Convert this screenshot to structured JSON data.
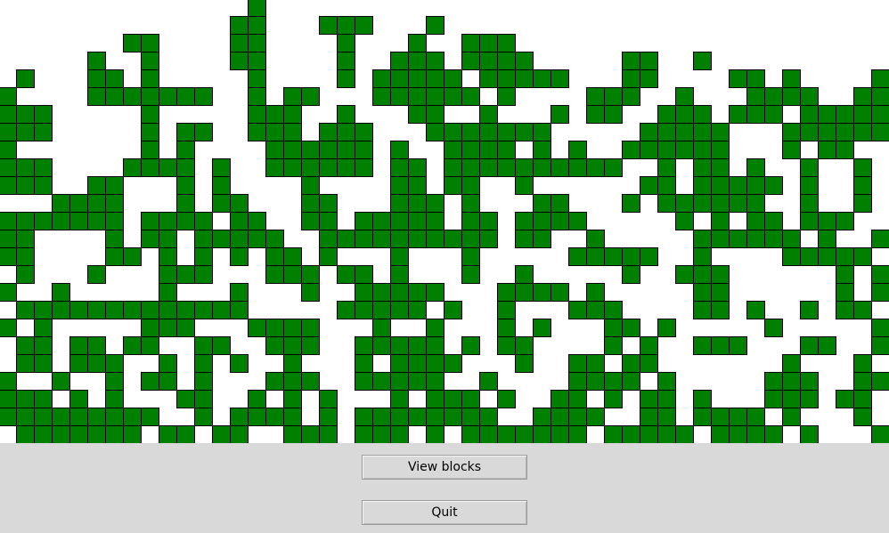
{
  "buttons": {
    "view": "View blocks",
    "quit": "Quit"
  },
  "grid": {
    "columns": 50,
    "rows": 25,
    "fill_color": "#008000",
    "outline_color": "#000000",
    "background_color": "#ffffff",
    "rows_data": [
      "..............#...................................",
      ".............##...###...#.........................",
      ".......##....##....#...#..###.....................",
      ".....#..#....##....#..###.####.....##..#.........",
      ".#...##.#.....#....#.#####.#####...##....##.#....#",
      "#....#######..#.##...######.#....###..#...####..##",
      "###.....#.....###..#...##..#...#.##..###.###.#####",
      "###.....#.##..###.###...#######.....#####...######",
      "#.......#.#....######.#..####.#.#..######...#.##..",
      "###....####.#..######.##.##########..#.##.#..#..#.",
      "###..##...#.#....#....##.##..#......##.#####.#..#.",
      "...####...#.##...##...###.#...##...#.######..#..#.",
      "#######.####.##..##.#####.##.####.....#.#.##.###..",
      "##....#.##.#####..##########.##..#.....######.#..#",
      "##....##.#.#.#.##.#...#...#.....#####..#....#####.",
      ".#...#...###...###.##.#...#..#.....#..###......#.#",
      "#..#.....#...#...#..#####...####.#.....##......#.#",
      ".#############.....#####.#..#...###....##.#..#.##.",
      "#.#.....###...####...#..#...#.#...##.#.....#.....#",
      ".##.##.##..##..###..#####.#.##....#.#..###...##..#",
      ".##.###..#.#.#..#...#.####...#..##.##.......#...#.",
      "#..#..#.##.#...###..#####..#....####.#.....###..##",
      "###.#.#...##..#.#.#...#.###.#..##.#.##.#...###.##.",
      "#########..#.####.#.########..####..##.####.#...#.",
      ".#######.##.##..###.###.#.#######.#####.####.#...##"
    ]
  }
}
